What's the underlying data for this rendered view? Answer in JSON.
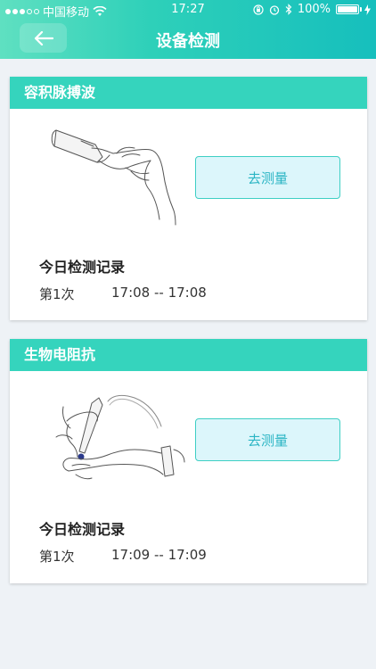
{
  "status_bar": {
    "carrier": "中国移动",
    "time": "17:27",
    "battery": "100%"
  },
  "nav": {
    "title": "设备检测"
  },
  "cards": [
    {
      "title": "容积脉搏波",
      "button_label": "去测量",
      "record_title": "今日检测记录",
      "records": [
        {
          "count": "第1次",
          "time": "17:08 -- 17:08"
        }
      ]
    },
    {
      "title": "生物电阻抗",
      "button_label": "去测量",
      "record_title": "今日检测记录",
      "records": [
        {
          "count": "第1次",
          "time": "17:09 -- 17:09"
        }
      ]
    }
  ],
  "colors": {
    "header_gradient_start": "#5fe0c1",
    "header_gradient_end": "#16bfbd",
    "card_header": "#35d4bd",
    "button_bg": "#dcf6fb",
    "button_border": "#3ecfc4",
    "button_text": "#2bb5c4",
    "page_bg": "#eef2f6"
  },
  "icons": {
    "back": "arrow-left-icon",
    "wifi": "wifi-icon",
    "lock": "orientation-lock-icon",
    "alarm": "alarm-icon",
    "bluetooth": "bluetooth-icon",
    "battery": "battery-icon",
    "charging": "charging-bolt-icon"
  }
}
